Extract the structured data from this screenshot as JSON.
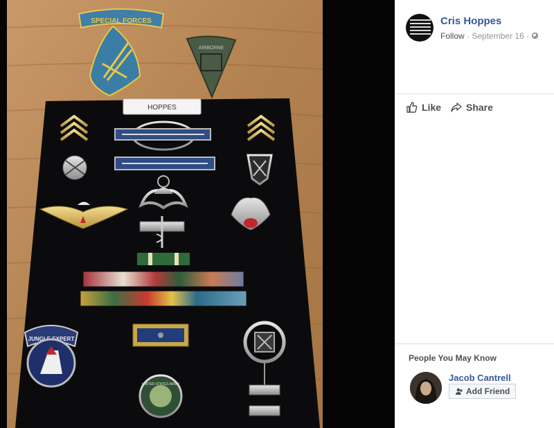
{
  "post": {
    "author": "Cris Hoppes",
    "follow_label": "Follow",
    "date": "September 16",
    "separator": "·",
    "privacy_icon": "globe-icon"
  },
  "actions": {
    "like_label": "Like",
    "share_label": "Share"
  },
  "photo": {
    "patch_top_text": "SPECIAL FORCES",
    "patch_right_text": "AIRBORNE",
    "nameplate": "HOPPES",
    "jungle_badge_text": "JUNGLE EXPERT",
    "round_badge_text": "UNITED STATES ARMY"
  },
  "pymk": {
    "title": "People You May Know",
    "person_name": "Jacob Cantrell",
    "add_friend_label": "Add Friend"
  },
  "colors": {
    "link_blue": "#365899",
    "meta_gray": "#90949c",
    "text_dark": "#4b4f56",
    "wood": "#b98a5a",
    "felt": "#0b0b0d"
  }
}
